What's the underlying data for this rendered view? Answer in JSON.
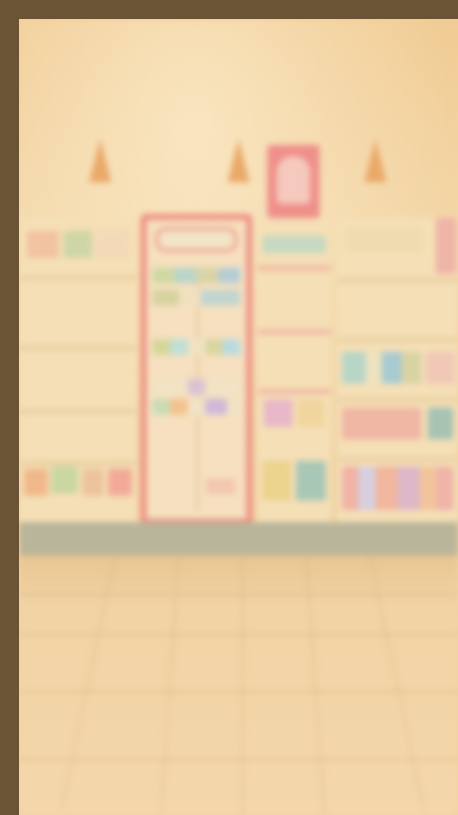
{
  "scene": {
    "name": "convenience-store-interior",
    "state": "blurred-background",
    "palette": {
      "frame": "#6b5336",
      "wall": "#f1cc94",
      "floor": "#f3d7aa",
      "accent": "#ec8a7e"
    }
  }
}
